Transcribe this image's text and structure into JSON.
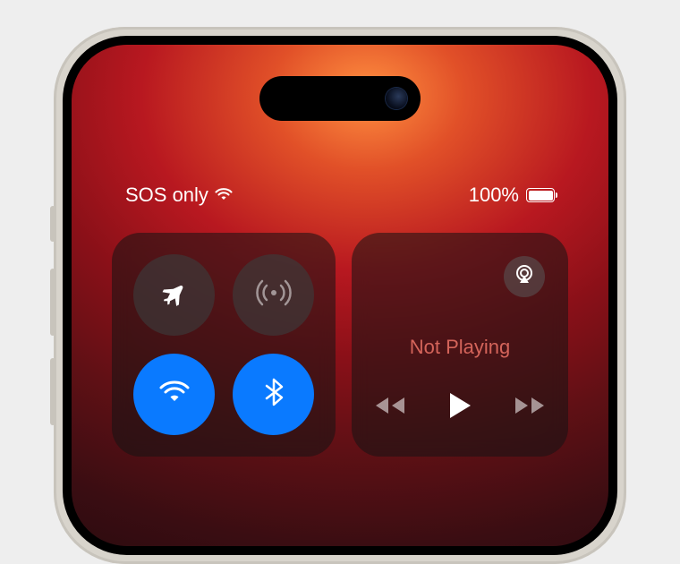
{
  "status": {
    "network_text": "SOS only",
    "battery_percent": "100%"
  },
  "connectivity": {
    "airplane_mode": false,
    "cellular_data": false,
    "wifi": true,
    "bluetooth": true
  },
  "media": {
    "status": "Not Playing"
  }
}
